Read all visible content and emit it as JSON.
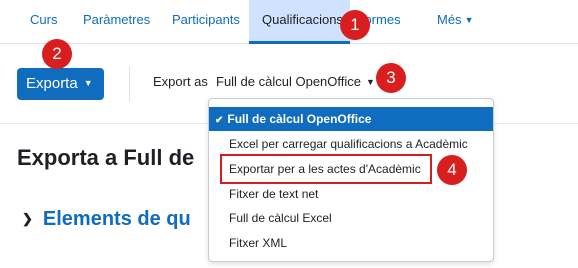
{
  "nav": {
    "tabs": [
      {
        "label": "Curs"
      },
      {
        "label": "Paràmetres"
      },
      {
        "label": "Participants"
      },
      {
        "label": "Qualificacions",
        "active": true
      },
      {
        "label": "Informes"
      },
      {
        "label": "Més"
      }
    ]
  },
  "toolbar": {
    "export_button_label": "Exporta",
    "export_as_label": "Export as",
    "export_as_value": "Full de càlcul OpenOffice"
  },
  "dropdown": {
    "options": [
      {
        "label": "Full de càlcul OpenOffice",
        "selected": true
      },
      {
        "label": "Excel per carregar qualificacions a Acadèmic"
      },
      {
        "label": "Exportar per a les actes d'Acadèmic"
      },
      {
        "label": "Fitxer de text net"
      },
      {
        "label": "Full de càlcul Excel"
      },
      {
        "label": "Fitxer XML"
      }
    ]
  },
  "page": {
    "title": "Exporta a Full de",
    "section_heading": "Elements de qu"
  },
  "callouts": [
    "1",
    "2",
    "3",
    "4"
  ],
  "colors": {
    "brand": "#0f6cbf",
    "active_tab_bg": "#cfe2ff",
    "callout": "#d81e1e"
  }
}
